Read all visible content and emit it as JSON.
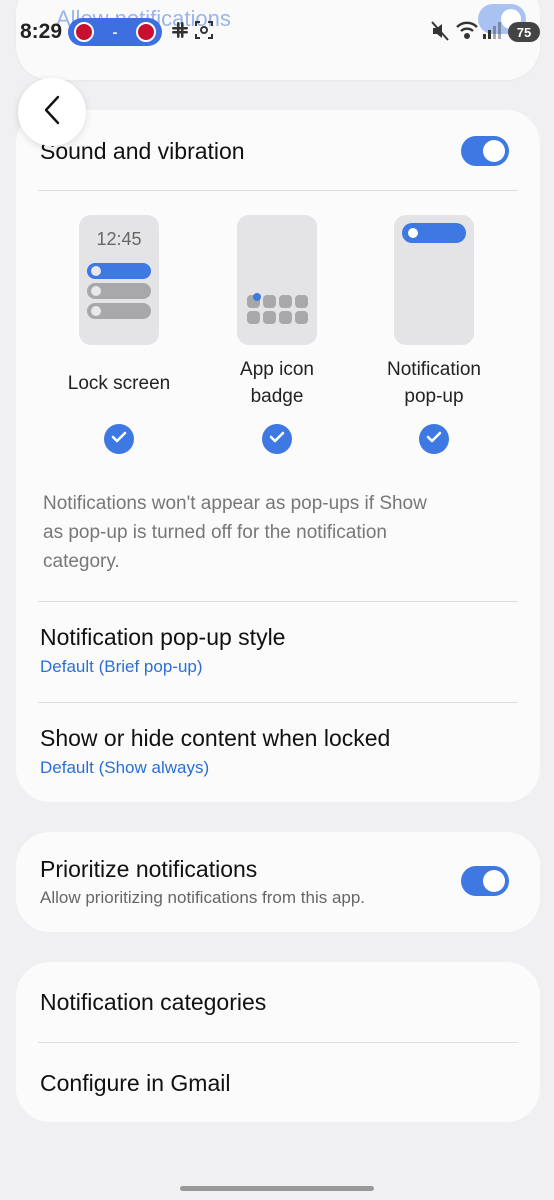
{
  "status": {
    "time": "8:29",
    "battery": "75",
    "pill_dash": "-"
  },
  "top_card": {
    "title": "Allow notifications"
  },
  "sound": {
    "label": "Sound and vibration",
    "enabled": true
  },
  "previews": {
    "lock_time": "12:45",
    "lock_label": "Lock screen",
    "badge_label_1": "App icon",
    "badge_label_2": "badge",
    "popup_label_1": "Notification",
    "popup_label_2": "pop-up"
  },
  "info": {
    "line1": "Notifications won't appear as pop-ups if Show",
    "line2": "as pop-up is turned off for the notification",
    "line3": "category."
  },
  "popup_style": {
    "title": "Notification pop-up style",
    "value": "Default (Brief pop-up)"
  },
  "locked_content": {
    "title": "Show or hide content when locked",
    "value": "Default (Show always)"
  },
  "prioritize": {
    "title": "Prioritize notifications",
    "desc": "Allow prioritizing notifications from this app.",
    "enabled": true
  },
  "categories": {
    "label": "Notification categories"
  },
  "configure": {
    "label": "Configure in Gmail"
  },
  "colors": {
    "accent": "#3d78e3",
    "link": "#2a6fd6",
    "background": "#f0f0f2"
  },
  "icons": [
    "back-chevron-icon",
    "check-icon",
    "mute-icon",
    "wifi-icon",
    "signal-icon",
    "slack-icon",
    "screenshot-icon"
  ]
}
